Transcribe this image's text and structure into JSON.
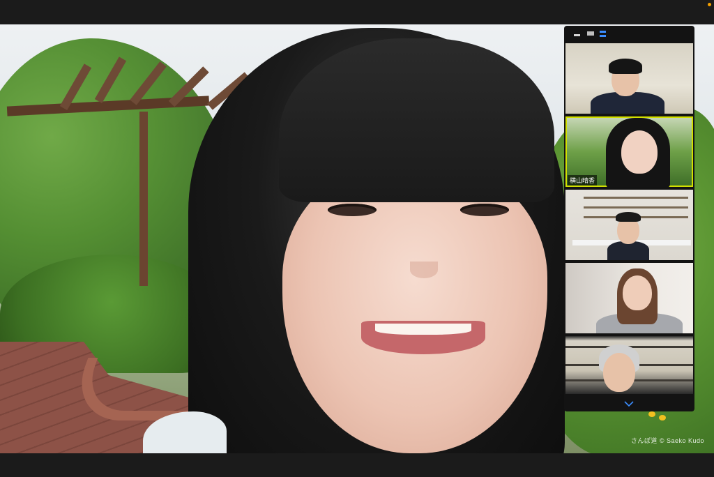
{
  "gallery": {
    "toolbar": {
      "minimize_icon": "minimize-icon",
      "strip_icon": "filmstrip-view-icon",
      "grid_icon": "gallery-grid-icon"
    },
    "participants": [
      {
        "name": "",
        "active": false
      },
      {
        "name": "横山晴香",
        "active": true
      },
      {
        "name": "",
        "active": false
      },
      {
        "name": "",
        "active": false
      },
      {
        "name": "",
        "active": false
      }
    ],
    "scroll_icon": "chevron-down-icon"
  },
  "main_video": {
    "watermark": "さんぽ道 © Saeko Kudo"
  },
  "colors": {
    "active_speaker_border": "#d3e000",
    "grid_icon_accent": "#3b8dff",
    "recording_dot": "#f5a000"
  }
}
